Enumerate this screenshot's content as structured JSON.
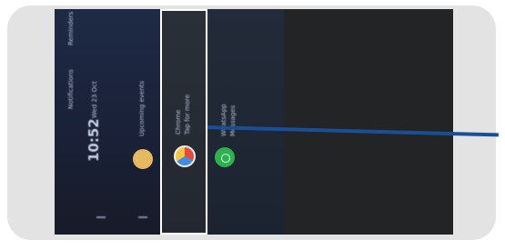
{
  "screen": {
    "panel1": {
      "header_left": "Notifications",
      "header_right": "Reminders",
      "clock": "10:52",
      "date_line": "Wed 23 Oct",
      "app_name": "Upcoming events"
    },
    "panel2": {
      "app_name": "Chrome",
      "label": "Tap for more"
    },
    "panel3": {
      "app_name": "WhatsApp",
      "label": "Messages"
    }
  },
  "colors": {
    "highlight_border": "#ffffff",
    "callout_line": "#1a4f98"
  }
}
